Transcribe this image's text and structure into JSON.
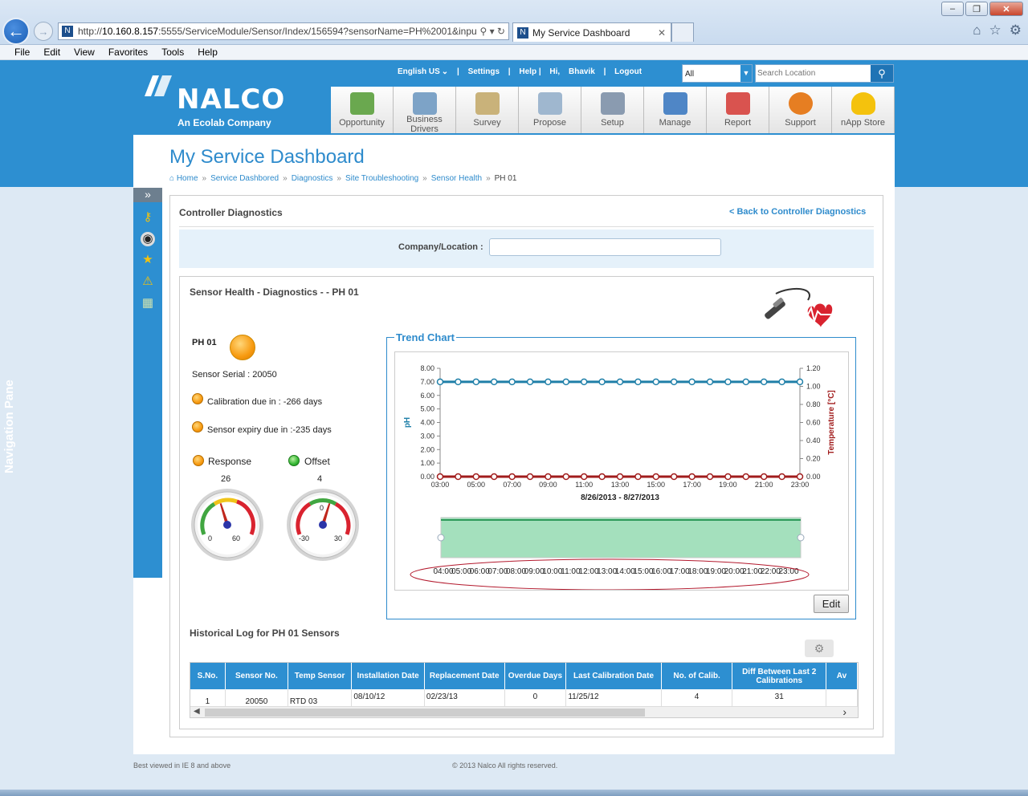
{
  "browser": {
    "url_prefix": "http://",
    "url_host": "10.160.8.157",
    "url_rest": ":5555/ServiceModule/Sensor/Index/156594?sensorName=PH%2001&inpu",
    "tab_title": "My Service Dashboard",
    "menu": [
      "File",
      "Edit",
      "View",
      "Favorites",
      "Tools",
      "Help"
    ]
  },
  "header": {
    "logo_name": "NALCO",
    "logo_sub": "An Ecolab Company",
    "top_links": [
      "English US",
      "|",
      "Settings",
      "|",
      "Help |",
      "Hi,",
      "Bhavik",
      "|",
      "Logout"
    ],
    "select_value": "All",
    "search_placeholder": "Search Location",
    "nav": [
      {
        "label": "Opportunity",
        "color": "#6aa84f"
      },
      {
        "label": "Business Drivers",
        "color": "#7da3c7"
      },
      {
        "label": "Survey",
        "color": "#c9b27a"
      },
      {
        "label": "Propose",
        "color": "#9fb7cf"
      },
      {
        "label": "Setup",
        "color": "#8a9bb0"
      },
      {
        "label": "Manage",
        "color": "#4f86c6"
      },
      {
        "label": "Report",
        "color": "#d9534f"
      },
      {
        "label": "Support",
        "color": "#e67e22"
      },
      {
        "label": "nApp Store",
        "color": "#f4c20d"
      }
    ]
  },
  "page": {
    "title": "My Service Dashboard",
    "breadcrumb": [
      "Home",
      "Service Dashbored",
      "Diagnostics",
      "Site Troubleshooting",
      "Sensor Health",
      "PH 01"
    ],
    "nav_pane_label": "Navigation Pane"
  },
  "controller": {
    "title": "Controller Diagnostics",
    "back_link": "<  Back to Controller Diagnostics",
    "company_label": "Company/Location :"
  },
  "sensor": {
    "panel_title": "Sensor Health - Diagnostics - - PH 01",
    "name": "PH 01",
    "serial": "Sensor Serial : 20050",
    "calibration": "Calibration due in : -266 days",
    "expiry": "Sensor expiry due in :-235 days",
    "response_label": "Response",
    "response_value": "26",
    "response_min": "0",
    "response_max": "60",
    "offset_label": "Offset",
    "offset_value": "4",
    "offset_min": "-30",
    "offset_max": "30",
    "offset_mid": "0"
  },
  "chart_data": {
    "type": "line",
    "title": "Trend Chart",
    "xlabel": "8/26/2013 - 8/27/2013",
    "ylabel": "pH",
    "y2label": "Temperature [°C]",
    "x_ticks": [
      "03:00",
      "05:00",
      "07:00",
      "09:00",
      "11:00",
      "13:00",
      "15:00",
      "17:00",
      "19:00",
      "21:00",
      "23:00"
    ],
    "y_ticks": [
      "0.00",
      "1.00",
      "2.00",
      "3.00",
      "4.00",
      "5.00",
      "6.00",
      "7.00",
      "8.00"
    ],
    "y2_ticks": [
      "0.00",
      "0.20",
      "0.40",
      "0.60",
      "0.80",
      "1.00",
      "1.20"
    ],
    "ylim": [
      0,
      8
    ],
    "y2lim": [
      0,
      1.2
    ],
    "x_hours": [
      3,
      4,
      5,
      6,
      7,
      8,
      9,
      10,
      11,
      12,
      13,
      14,
      15,
      16,
      17,
      18,
      19,
      20,
      21,
      22,
      23
    ],
    "series": [
      {
        "axis": "left",
        "color": "#1f7fa8",
        "values": [
          7,
          7,
          7,
          7,
          7,
          7,
          7,
          7,
          7,
          7,
          7,
          7,
          7,
          7,
          7,
          7,
          7,
          7,
          7,
          7,
          7
        ]
      },
      {
        "axis": "right",
        "color": "#a11d1d",
        "values": [
          0,
          0,
          0,
          0,
          0,
          0,
          0,
          0,
          0,
          0,
          0,
          0,
          0,
          0,
          0,
          0,
          0,
          0,
          0,
          0,
          0
        ]
      }
    ],
    "navigator_ticks": [
      "04:00",
      "05:00",
      "06:00",
      "07:00",
      "08:00",
      "09:00",
      "10:00",
      "11:00",
      "12:00",
      "13:00",
      "14:00",
      "15:00",
      "16:00",
      "17:00",
      "18:00",
      "19:00",
      "20:00",
      "21:00",
      "22:00",
      "23:00"
    ],
    "grid": false
  },
  "edit_label": "Edit",
  "history": {
    "title": "Historical Log for PH 01 Sensors",
    "columns": [
      "S.No.",
      "Sensor No.",
      "Temp Sensor",
      "Installation Date",
      "Replacement Date",
      "Overdue Days",
      "Last Calibration Date",
      "No. of Calib.",
      "Diff Between Last 2 Calibrations",
      "Av"
    ],
    "rows": [
      [
        "1",
        "20050",
        "RTD 03",
        "08/10/12",
        "02/23/13",
        "0",
        "11/25/12",
        "4",
        "31",
        ""
      ]
    ]
  },
  "footer": {
    "left": "Best viewed in IE 8 and above",
    "center": "© 2013 Nalco All rights reserved."
  },
  "colors": {
    "brand_blue": "#2d8fd1",
    "ph_line": "#1f7fa8",
    "temp_line": "#a11d1d",
    "navigator_fill": "#a4e0bd"
  }
}
